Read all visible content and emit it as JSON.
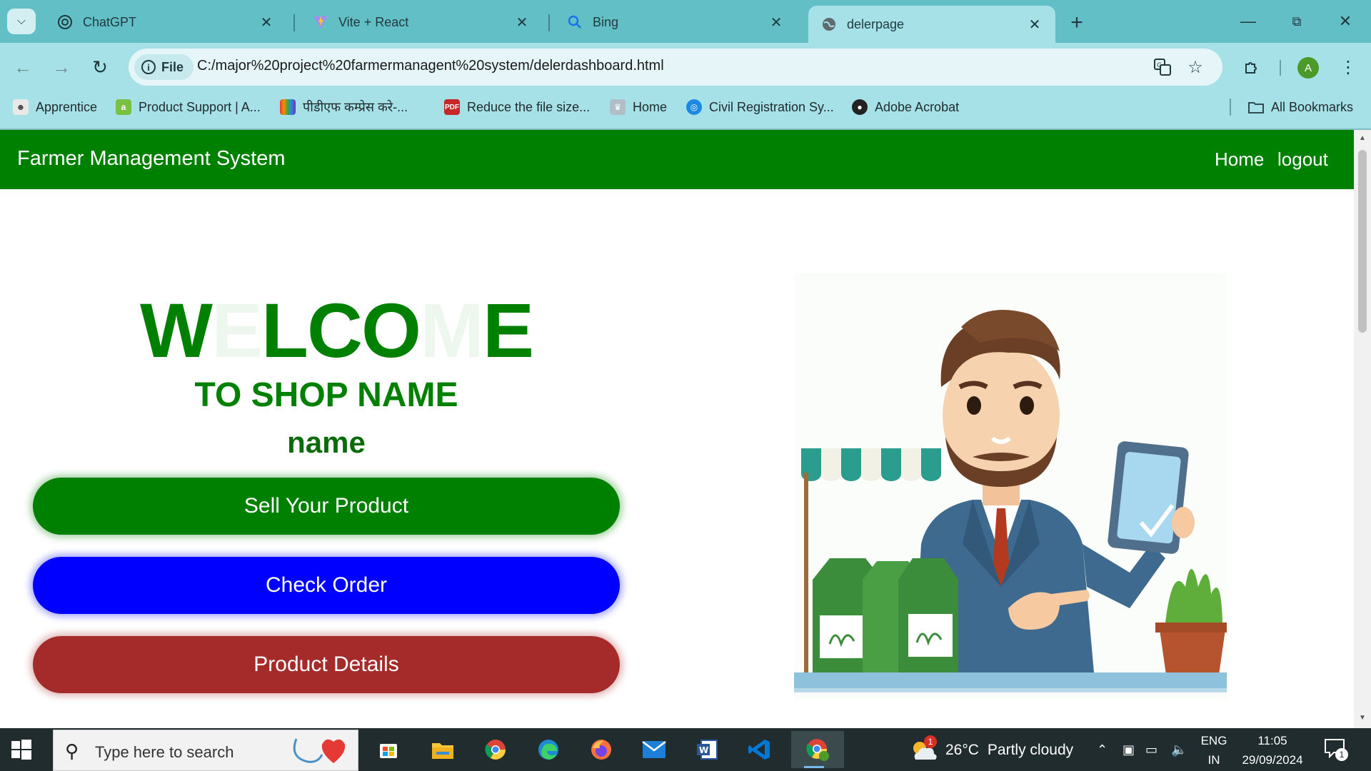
{
  "browser": {
    "tabs": [
      {
        "title": "ChatGPT",
        "icon": "openai-icon",
        "active": false
      },
      {
        "title": "Vite + React",
        "icon": "vite-icon",
        "active": false
      },
      {
        "title": "Bing",
        "icon": "bing-search-icon",
        "active": false
      },
      {
        "title": "delerpage",
        "icon": "globe-icon",
        "active": true
      }
    ],
    "address": {
      "chip_label": "File",
      "url": "C:/major%20project%20farmermanagent%20system/delerdashboard.html"
    },
    "profile_initial": "A",
    "bookmarks": [
      {
        "label": "Apprentice"
      },
      {
        "label": "Product Support | A..."
      },
      {
        "label": "पीडीएफ कम्प्रेस करे-..."
      },
      {
        "label": "Reduce the file size..."
      },
      {
        "label": "Home"
      },
      {
        "label": "Civil Registration Sy..."
      },
      {
        "label": "Adobe Acrobat"
      }
    ],
    "all_bookmarks_label": "All Bookmarks"
  },
  "page": {
    "brand": "Farmer Management System",
    "nav": {
      "home": "Home",
      "logout": "logout"
    },
    "welcome_letters": [
      {
        "ch": "W",
        "faint": false
      },
      {
        "ch": "E",
        "faint": true
      },
      {
        "ch": "L",
        "faint": false
      },
      {
        "ch": "C",
        "faint": false
      },
      {
        "ch": "O",
        "faint": false
      },
      {
        "ch": "M",
        "faint": true
      },
      {
        "ch": "E",
        "faint": false
      }
    ],
    "subtitle": "TO SHOP NAME",
    "shop_name": "name",
    "buttons": {
      "sell": "Sell Your Product",
      "order": "Check Order",
      "details": "Product Details"
    },
    "colors": {
      "navbar": "#008000",
      "sell": "#008000",
      "order": "#0000ff",
      "details": "#a52a2a"
    }
  },
  "taskbar": {
    "search_placeholder": "Type here to search",
    "weather": {
      "temp": "26°C",
      "desc": "Partly cloudy",
      "badge": "1"
    },
    "lang": {
      "line1": "ENG",
      "line2": "IN"
    },
    "clock": {
      "time": "11:05",
      "date": "29/09/2024"
    },
    "notification_count": "1"
  }
}
